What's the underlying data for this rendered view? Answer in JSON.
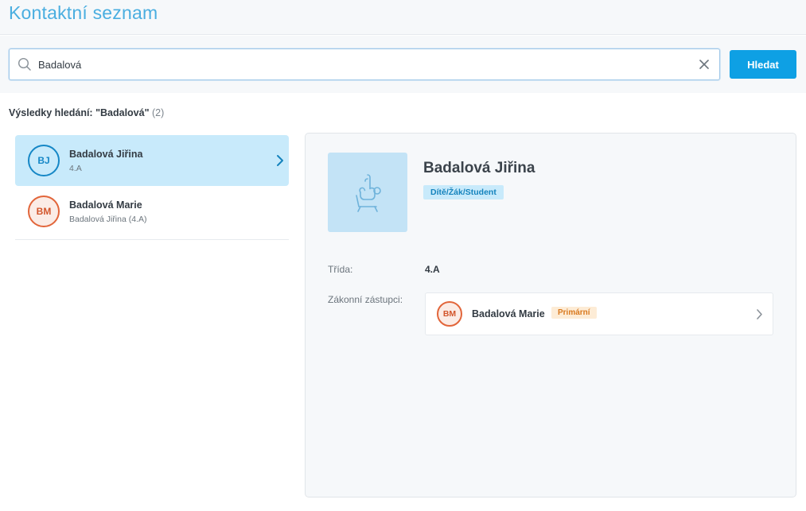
{
  "header": {
    "title": "Kontaktní seznam"
  },
  "search": {
    "value": "Badalová",
    "button_label": "Hledat"
  },
  "results": {
    "heading": "Výsledky hledání: \"Badalová\"",
    "count": "(2)",
    "items": [
      {
        "initials": "BJ",
        "name": "Badalová Jiřina",
        "sub": "4.A",
        "active": true
      },
      {
        "initials": "BM",
        "name": "Badalová Marie",
        "sub": "Badalová Jiřina (4.A)",
        "active": false
      }
    ]
  },
  "detail": {
    "name": "Badalová Jiřina",
    "role": "Dítě/Žák/Student",
    "class_label": "Třída:",
    "class_value": "4.A",
    "guardians_label": "Zákonní zástupci:",
    "guardian": {
      "initials": "BM",
      "name": "Badalová Marie",
      "badge": "Primární"
    }
  },
  "colors": {
    "accent": "#0ea0e4",
    "title": "#4aaee0",
    "active_row": "#c8eafb",
    "primary_badge": "#fdecd6"
  },
  "icons": [
    "search-icon",
    "clear-icon",
    "chevron-right-icon",
    "student-raised-hand-icon"
  ]
}
